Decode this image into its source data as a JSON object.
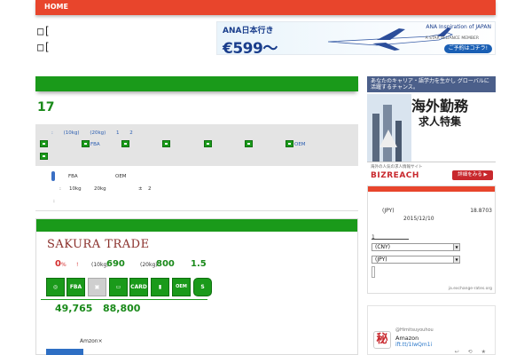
{
  "nav": {
    "home": "HOME"
  },
  "site": {
    "title_line1": "□[",
    "title_line2": "□["
  },
  "ad_ana": {
    "line1": "ANA日本行き",
    "price": "€599～",
    "brand": "ANA Inspiration of JAPAN",
    "alliance": "A STAR ALLIANCE MEMBER",
    "cta": "ご予約はコチラ!"
  },
  "main": {
    "count": "17",
    "info": {
      "row1": [
        ":",
        "(10kg)",
        "(20kg)",
        "1",
        "2"
      ],
      "icon_labels": {
        "fba": "FBA",
        "oem": "OEM"
      }
    },
    "detail": {
      "fba": "FBA",
      "oem": "OEM",
      "colon": ":",
      "w10": "10kg",
      "w20": "20kg",
      "pm": "±",
      "two": "2",
      "colon2": ":"
    }
  },
  "product": {
    "name": "SAKURA TRADE",
    "rate": "0",
    "rate_unit": "%",
    "bang": "!",
    "w10_label": "(10kg)",
    "w10_value": "690",
    "w20_label": "(20kg)",
    "w20_value": "800",
    "ratio": "1.5",
    "icons": [
      "FBA",
      "CARD",
      "OEM"
    ],
    "price1": "49,765",
    "price2": "88,800",
    "amazon_label": "Amzon×"
  },
  "ad_biz": {
    "top": "あなたのキャリア・語学力を生かし グローバルに活躍するチャンス。",
    "head1": "海外勤務",
    "head2": "求人特集",
    "foot_text": "海外の人気の求人情報サイト",
    "logo": "BIZREACH",
    "btn": "詳細をみる ▶"
  },
  "currency": {
    "jpy_label": "(JPY)",
    "rate": "18.8703",
    "date": "2015/12/10",
    "input_prefix": "1",
    "from": "(CNY)",
    "to": "(JPY)",
    "source": "ja.exchange-rates.org"
  },
  "tweet": {
    "avatar": "秘",
    "handle": "@Himitsuyouhou",
    "text": "Amazon",
    "link": "ift.tt/1IwQm1i",
    "actions": "↩ ⟲ ★"
  },
  "colors": {
    "accent": "#e8452c",
    "green": "#1a9a1a",
    "title_red": "#8a2f2a"
  }
}
